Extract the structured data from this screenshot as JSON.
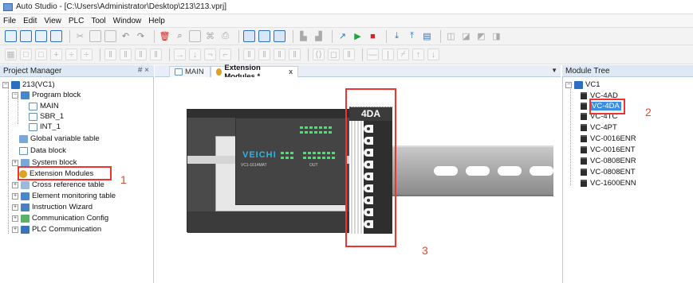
{
  "window": {
    "title": "Auto Studio - [C:\\Users\\Administrator\\Desktop\\213\\213.vprj]"
  },
  "menu": [
    {
      "label": "File",
      "u": "F"
    },
    {
      "label": "Edit",
      "u": "E"
    },
    {
      "label": "View",
      "u": "V"
    },
    {
      "label": "PLC",
      "u": "P"
    },
    {
      "label": "Tool",
      "u": "T"
    },
    {
      "label": "Window",
      "u": "W"
    },
    {
      "label": "Help",
      "u": "H"
    }
  ],
  "project_manager": {
    "header": "Project Manager",
    "pin": "# ×",
    "root": "213(VC1)",
    "program_block": "Program block",
    "main": "MAIN",
    "sbr": "SBR_1",
    "int": "INT_1",
    "global_vars": "Global variable table",
    "data_block": "Data block",
    "system_block": "System block",
    "ext_modules": "Extension Modules",
    "cross_ref": "Cross reference table",
    "elem_monitor": "Element monitoring table",
    "instr_wizard": "Instruction Wizard",
    "comm_config": "Communication Config",
    "plc_comm": "PLC Communication",
    "annotation": "1"
  },
  "tabs": {
    "main": "MAIN",
    "ext": "Extension Modules *",
    "close": "x"
  },
  "canvas": {
    "plc_logo": "VEICHI",
    "plc_model": "VC1-1614MAT",
    "plc_out": "OUT",
    "module_label": "4DA",
    "annotation": "3"
  },
  "module_tree": {
    "header": "Module Tree",
    "root": "VC1",
    "items": [
      "VC-4AD",
      "VC-4DA",
      "VC-4TC",
      "VC-4PT",
      "VC-0016ENR",
      "VC-0016ENT",
      "VC-0808ENR",
      "VC-0808ENT",
      "VC-1600ENN"
    ],
    "selected": "VC-4DA",
    "annotation": "2"
  }
}
